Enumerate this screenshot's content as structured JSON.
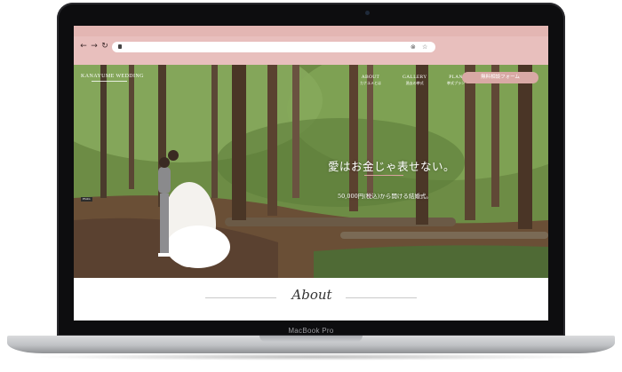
{
  "device": {
    "label": "MacBook Pro"
  },
  "browser": {
    "back_icon": "←",
    "forward_icon": "→",
    "reload_icon": "↻",
    "clear_icon": "⊗",
    "star_icon": "☆"
  },
  "site": {
    "logo": "KANAYUME WEDDING",
    "nav": [
      {
        "en": "ABOUT",
        "ja": "カナユメとは"
      },
      {
        "en": "GALLERY",
        "ja": "過去の挙式"
      },
      {
        "en": "PLAN",
        "ja": "挙式プラン"
      }
    ],
    "cta": "無料相談フォーム",
    "hero": {
      "headline": "愛はお金じゃ表せない。",
      "subline": "50,000円(税込)から開ける結婚式。",
      "badge": "Photo"
    },
    "about_title": "About"
  },
  "colors": {
    "chrome": "#e8bfbd",
    "accent": "#d9a9a5"
  }
}
